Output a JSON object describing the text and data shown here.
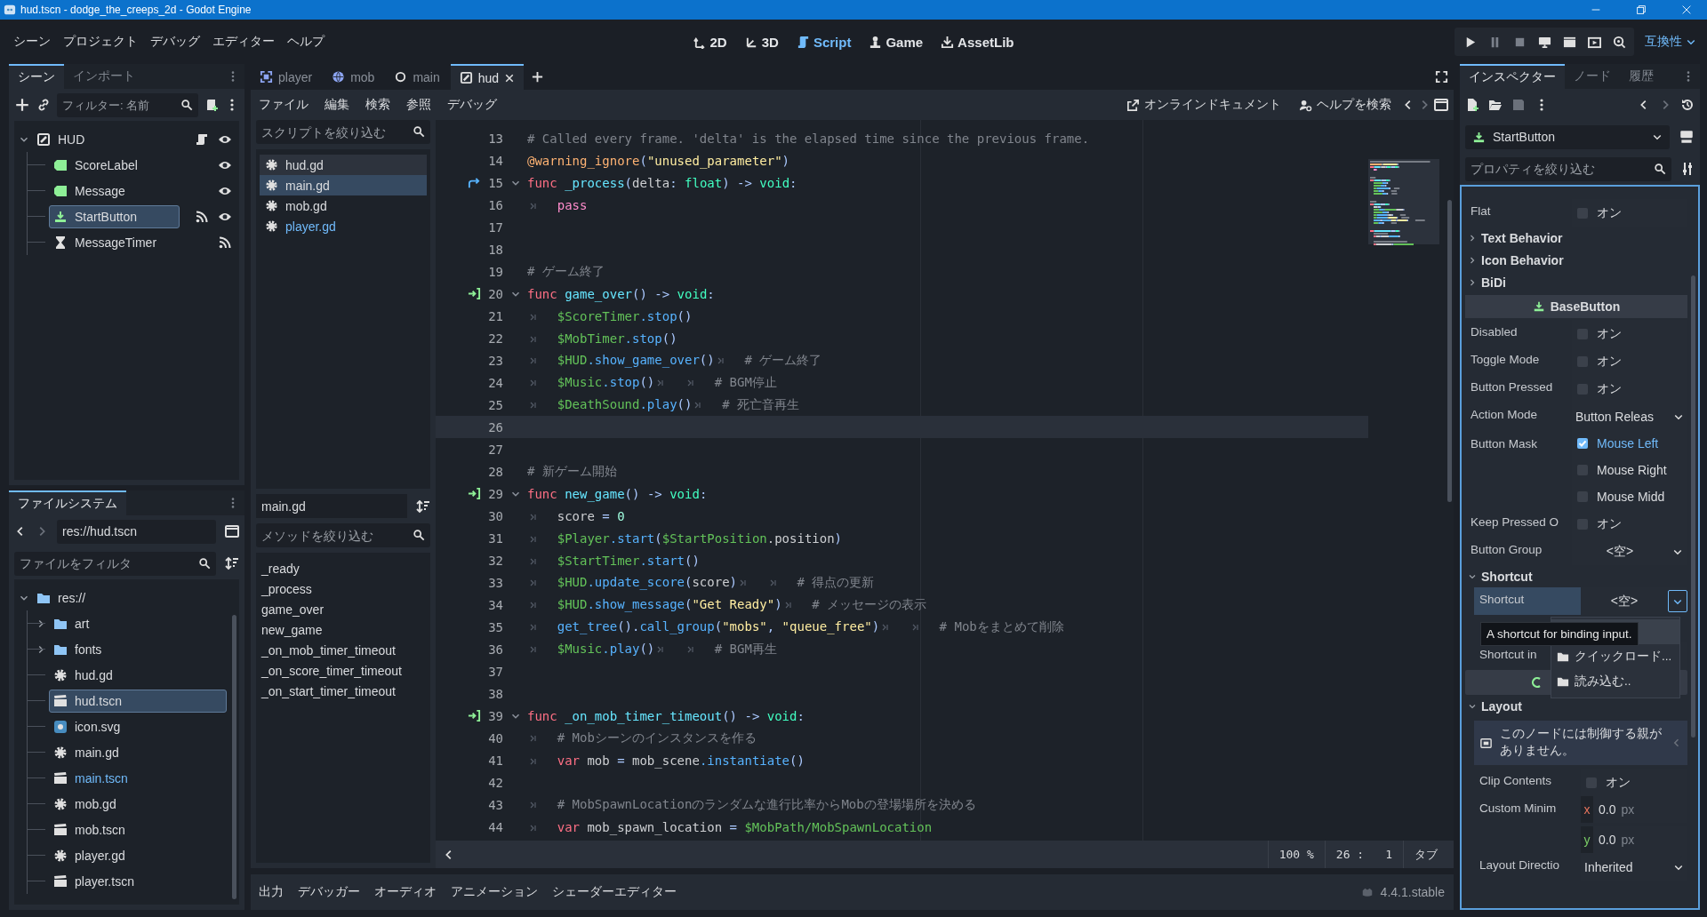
{
  "title_bar": {
    "title": "hud.tscn - dodge_the_creeps_2d - Godot Engine"
  },
  "menu": [
    "シーン",
    "プロジェクト",
    "デバッグ",
    "エディター",
    "ヘルプ"
  ],
  "workspaces": [
    {
      "label": "2D",
      "kind": "ws2d",
      "selected": false
    },
    {
      "label": "3D",
      "kind": "ws3d",
      "selected": false
    },
    {
      "label": "Script",
      "kind": "wsscript",
      "selected": true
    },
    {
      "label": "Game",
      "kind": "wsgame",
      "selected": false
    },
    {
      "label": "AssetLib",
      "kind": "wsasset",
      "selected": false
    }
  ],
  "run_buttons": [
    {
      "kind": "play"
    },
    {
      "kind": "pause"
    },
    {
      "kind": "stop"
    },
    {
      "kind": "remote"
    },
    {
      "kind": "movie"
    },
    {
      "kind": "sceneplay"
    },
    {
      "kind": "searchscene"
    }
  ],
  "renderer": "互換性",
  "scene_dock": {
    "tabs": [
      {
        "label": "シーン",
        "selected": true
      },
      {
        "label": "インポート",
        "selected": false
      }
    ],
    "filter_placeholder": "フィルター: 名前",
    "tree": [
      {
        "name": "HUD",
        "kind": "canvaslayer",
        "expanded": true,
        "selected": false,
        "script": true,
        "visible": true,
        "children": [
          {
            "name": "ScoreLabel",
            "kind": "label",
            "selected": false,
            "visible": true
          },
          {
            "name": "Message",
            "kind": "label",
            "selected": false,
            "visible": true
          },
          {
            "name": "StartButton",
            "kind": "button",
            "selected": true,
            "signals": true,
            "visible": true
          },
          {
            "name": "MessageTimer",
            "kind": "timer",
            "selected": false,
            "signals": true
          }
        ]
      }
    ]
  },
  "filesystem": {
    "tab": "ファイルシステム",
    "path": "res://hud.tscn",
    "filter_placeholder": "ファイルをフィルタ",
    "tree": [
      {
        "name": "res://",
        "kind": "folder",
        "expanded": true,
        "selected": false,
        "children": [
          {
            "name": "art",
            "kind": "folder",
            "expanded": false,
            "selected": false
          },
          {
            "name": "fonts",
            "kind": "folder",
            "expanded": false,
            "selected": false
          },
          {
            "name": "hud.gd",
            "kind": "gear",
            "selected": false
          },
          {
            "name": "hud.tscn",
            "kind": "scene",
            "selected": true
          },
          {
            "name": "icon.svg",
            "kind": "image",
            "selected": false
          },
          {
            "name": "main.gd",
            "kind": "gear",
            "selected": false
          },
          {
            "name": "main.tscn",
            "kind": "scene",
            "selected": false,
            "accent": true
          },
          {
            "name": "mob.gd",
            "kind": "gear",
            "selected": false
          },
          {
            "name": "mob.tscn",
            "kind": "scene",
            "selected": false
          },
          {
            "name": "player.gd",
            "kind": "gear",
            "selected": false
          },
          {
            "name": "player.tscn",
            "kind": "scene",
            "selected": false
          }
        ]
      }
    ]
  },
  "editor_tabs": [
    {
      "label": "player",
      "kind": "area2d",
      "selected": false
    },
    {
      "label": "mob",
      "kind": "rigidbody2d",
      "selected": false
    },
    {
      "label": "main",
      "kind": "node",
      "selected": false
    },
    {
      "label": "hud",
      "kind": "canvaslayer",
      "selected": true
    }
  ],
  "script_menu": [
    "ファイル",
    "編集",
    "検索",
    "参照",
    "デバッグ"
  ],
  "script_links": [
    {
      "label": "オンラインドキュメント",
      "kind": "external"
    },
    {
      "label": "ヘルプを検索",
      "kind": "helpsearch"
    }
  ],
  "scripts": {
    "filter_placeholder": "スクリプトを絞り込む",
    "items": [
      {
        "name": "hud.gd",
        "selected": false,
        "hovered": true,
        "accent": false
      },
      {
        "name": "main.gd",
        "selected": true,
        "hovered": false,
        "accent": false
      },
      {
        "name": "mob.gd",
        "selected": false,
        "hovered": false,
        "accent": false
      },
      {
        "name": "player.gd",
        "selected": false,
        "hovered": false,
        "accent": true
      }
    ],
    "current": "main.gd",
    "method_filter_placeholder": "メソッドを絞り込む",
    "methods": [
      "_ready",
      "_process",
      "game_over",
      "new_game",
      "_on_mob_timer_timeout",
      "_on_score_timer_timeout",
      "_on_start_timer_timeout"
    ]
  },
  "code": {
    "lines": [
      {
        "number": "13",
        "s": [
          {
            "kind": "cmt",
            "text": "# Called every frame. 'delta' is the elapsed time since the previous frame."
          }
        ]
      },
      {
        "number": "14",
        "s": [
          {
            "kind": "ann",
            "text": "@warning_ignore"
          },
          {
            "kind": "sym",
            "text": "("
          },
          {
            "kind": "str",
            "text": "\"unused_parameter\""
          },
          {
            "kind": "sym",
            "text": ")"
          }
        ]
      },
      {
        "number": "15",
        "kind": "override",
        "foldable": true,
        "s": [
          {
            "kind": "kw",
            "text": "func "
          },
          {
            "kind": "fn",
            "text": "_process"
          },
          {
            "kind": "sym",
            "text": "("
          },
          {
            "kind": "plain",
            "text": "delta"
          },
          {
            "kind": "sym",
            "text": ": "
          },
          {
            "kind": "type",
            "text": "float"
          },
          {
            "kind": "sym",
            "text": ") -> "
          },
          {
            "kind": "type",
            "text": "void"
          },
          {
            "kind": "sym",
            "text": ":"
          }
        ]
      },
      {
        "number": "16",
        "s": [
          {
            "kind": "tab"
          },
          {
            "kind": "ctrl",
            "text": "pass"
          }
        ]
      },
      {
        "number": "17"
      },
      {
        "number": "18"
      },
      {
        "number": "19",
        "s": [
          {
            "kind": "cmt",
            "text": "# ゲーム終了"
          }
        ]
      },
      {
        "number": "20",
        "kind": "signal",
        "foldable": true,
        "s": [
          {
            "kind": "kw",
            "text": "func "
          },
          {
            "kind": "fn",
            "text": "game_over"
          },
          {
            "kind": "sym",
            "text": "() -> "
          },
          {
            "kind": "type",
            "text": "void"
          },
          {
            "kind": "sym",
            "text": ":"
          }
        ]
      },
      {
        "number": "21",
        "s": [
          {
            "kind": "tab"
          },
          {
            "kind": "node",
            "text": "$ScoreTimer"
          },
          {
            "kind": "call",
            "text": ".stop"
          },
          {
            "kind": "sym",
            "text": "()"
          }
        ]
      },
      {
        "number": "22",
        "s": [
          {
            "kind": "tab"
          },
          {
            "kind": "node",
            "text": "$MobTimer"
          },
          {
            "kind": "call",
            "text": ".stop"
          },
          {
            "kind": "sym",
            "text": "()"
          }
        ]
      },
      {
        "number": "23",
        "s": [
          {
            "kind": "tab"
          },
          {
            "kind": "node",
            "text": "$HUD"
          },
          {
            "kind": "call",
            "text": ".show_game_over"
          },
          {
            "kind": "sym",
            "text": "()"
          },
          {
            "kind": "tab"
          },
          {
            "kind": "cmt",
            "text": "# ゲーム終了"
          }
        ]
      },
      {
        "number": "24",
        "s": [
          {
            "kind": "tab"
          },
          {
            "kind": "node",
            "text": "$Music"
          },
          {
            "kind": "call",
            "text": ".stop"
          },
          {
            "kind": "sym",
            "text": "()"
          },
          {
            "kind": "tab"
          },
          {
            "kind": "tab"
          },
          {
            "kind": "cmt",
            "text": "# BGM停止"
          }
        ]
      },
      {
        "number": "25",
        "s": [
          {
            "kind": "tab"
          },
          {
            "kind": "node",
            "text": "$DeathSound"
          },
          {
            "kind": "call",
            "text": ".play"
          },
          {
            "kind": "sym",
            "text": "()"
          },
          {
            "kind": "tab"
          },
          {
            "kind": "cmt",
            "text": "# 死亡音再生"
          }
        ]
      },
      {
        "number": "26",
        "current": true
      },
      {
        "number": "27"
      },
      {
        "number": "28",
        "s": [
          {
            "kind": "cmt",
            "text": "# 新ゲーム開始"
          }
        ]
      },
      {
        "number": "29",
        "kind": "signal",
        "foldable": true,
        "s": [
          {
            "kind": "kw",
            "text": "func "
          },
          {
            "kind": "fn",
            "text": "new_game"
          },
          {
            "kind": "sym",
            "text": "() -> "
          },
          {
            "kind": "type",
            "text": "void"
          },
          {
            "kind": "sym",
            "text": ":"
          }
        ]
      },
      {
        "number": "30",
        "s": [
          {
            "kind": "tab"
          },
          {
            "kind": "plain",
            "text": "score"
          },
          {
            "kind": "sym",
            "text": " = "
          },
          {
            "kind": "num",
            "text": "0"
          }
        ]
      },
      {
        "number": "31",
        "s": [
          {
            "kind": "tab"
          },
          {
            "kind": "node",
            "text": "$Player"
          },
          {
            "kind": "call",
            "text": ".start"
          },
          {
            "kind": "sym",
            "text": "("
          },
          {
            "kind": "node",
            "text": "$StartPosition"
          },
          {
            "kind": "plain",
            "text": ".position"
          },
          {
            "kind": "sym",
            "text": ")"
          }
        ]
      },
      {
        "number": "32",
        "s": [
          {
            "kind": "tab"
          },
          {
            "kind": "node",
            "text": "$StartTimer"
          },
          {
            "kind": "call",
            "text": ".start"
          },
          {
            "kind": "sym",
            "text": "()"
          }
        ]
      },
      {
        "number": "33",
        "s": [
          {
            "kind": "tab"
          },
          {
            "kind": "node",
            "text": "$HUD"
          },
          {
            "kind": "call",
            "text": ".update_score"
          },
          {
            "kind": "sym",
            "text": "("
          },
          {
            "kind": "plain",
            "text": "score"
          },
          {
            "kind": "sym",
            "text": ")"
          },
          {
            "kind": "tab"
          },
          {
            "kind": "tab"
          },
          {
            "kind": "cmt",
            "text": "# 得点の更新"
          }
        ]
      },
      {
        "number": "34",
        "s": [
          {
            "kind": "tab"
          },
          {
            "kind": "node",
            "text": "$HUD"
          },
          {
            "kind": "call",
            "text": ".show_message"
          },
          {
            "kind": "sym",
            "text": "("
          },
          {
            "kind": "str",
            "text": "\"Get Ready\""
          },
          {
            "kind": "sym",
            "text": ")"
          },
          {
            "kind": "tab"
          },
          {
            "kind": "cmt",
            "text": "# メッセージの表示"
          }
        ]
      },
      {
        "number": "35",
        "s": [
          {
            "kind": "tab"
          },
          {
            "kind": "call",
            "text": "get_tree"
          },
          {
            "kind": "sym",
            "text": "()."
          },
          {
            "kind": "call",
            "text": "call_group"
          },
          {
            "kind": "sym",
            "text": "("
          },
          {
            "kind": "str",
            "text": "\"mobs\""
          },
          {
            "kind": "sym",
            "text": ", "
          },
          {
            "kind": "str",
            "text": "\"queue_free\""
          },
          {
            "kind": "sym",
            "text": ")"
          },
          {
            "kind": "tab"
          },
          {
            "kind": "tab"
          },
          {
            "kind": "cmt",
            "text": "# Mobをまとめて削除"
          }
        ]
      },
      {
        "number": "36",
        "s": [
          {
            "kind": "tab"
          },
          {
            "kind": "node",
            "text": "$Music"
          },
          {
            "kind": "call",
            "text": ".play"
          },
          {
            "kind": "sym",
            "text": "()"
          },
          {
            "kind": "tab"
          },
          {
            "kind": "tab"
          },
          {
            "kind": "cmt",
            "text": "# BGM再生"
          }
        ]
      },
      {
        "number": "37"
      },
      {
        "number": "38"
      },
      {
        "number": "39",
        "kind": "signal",
        "foldable": true,
        "s": [
          {
            "kind": "kw",
            "text": "func "
          },
          {
            "kind": "fn",
            "text": "_on_mob_timer_timeout"
          },
          {
            "kind": "sym",
            "text": "() -> "
          },
          {
            "kind": "type",
            "text": "void"
          },
          {
            "kind": "sym",
            "text": ":"
          }
        ]
      },
      {
        "number": "40",
        "s": [
          {
            "kind": "tab"
          },
          {
            "kind": "cmt",
            "text": "# Mobシーンのインスタンスを作る"
          }
        ]
      },
      {
        "number": "41",
        "s": [
          {
            "kind": "tab"
          },
          {
            "kind": "kw",
            "text": "var"
          },
          {
            "kind": "plain",
            "text": " mob "
          },
          {
            "kind": "sym",
            "text": "= "
          },
          {
            "kind": "plain",
            "text": "mob_scene"
          },
          {
            "kind": "call",
            "text": ".instantiate"
          },
          {
            "kind": "sym",
            "text": "()"
          }
        ]
      },
      {
        "number": "42"
      },
      {
        "number": "43",
        "s": [
          {
            "kind": "tab"
          },
          {
            "kind": "cmt",
            "text": "# MobSpawnLocationのランダムな進行比率からMobの登場場所を決める"
          }
        ]
      },
      {
        "number": "44",
        "s": [
          {
            "kind": "tab"
          },
          {
            "kind": "kw",
            "text": "var"
          },
          {
            "kind": "plain",
            "text": " mob_spawn_location "
          },
          {
            "kind": "sym",
            "text": "= "
          },
          {
            "kind": "node",
            "text": "$MobPath/MobSpawnLocation"
          }
        ]
      }
    ],
    "status": {
      "zoom": "100 %",
      "line": "26 :",
      "column": "1",
      "indent": "タブ"
    }
  },
  "bottom_panel": {
    "tabs": [
      "出力",
      "デバッガー",
      "オーディオ",
      "アニメーション",
      "シェーダーエディター"
    ],
    "version": "4.4.1.stable"
  },
  "inspector": {
    "tabs": [
      {
        "label": "インスペクター",
        "selected": true
      },
      {
        "label": "ノード",
        "selected": false
      },
      {
        "label": "履歴",
        "selected": false
      }
    ],
    "object": "StartButton",
    "filter_placeholder": "プロパティを絞り込む",
    "rows": [
      {
        "kind": "check",
        "label": "Flat",
        "text": "オン",
        "checked": false
      },
      {
        "kind": "group",
        "label": "Text Behavior",
        "expanded": false
      },
      {
        "kind": "group",
        "label": "Icon Behavior",
        "expanded": false
      },
      {
        "kind": "group",
        "label": "BiDi",
        "expanded": false
      },
      {
        "kind": "category",
        "label": "BaseButton"
      },
      {
        "kind": "check",
        "label": "Disabled",
        "text": "オン",
        "checked": false
      },
      {
        "kind": "check",
        "label": "Toggle Mode",
        "text": "オン",
        "checked": false
      },
      {
        "kind": "check",
        "label": "Button Pressed",
        "text": "オン",
        "checked": false
      },
      {
        "kind": "dropdown",
        "label": "Action Mode",
        "value": "Button Releas"
      },
      {
        "kind": "flags",
        "label": "Button Mask",
        "options": [
          {
            "text": "Mouse Left",
            "checked": true
          },
          {
            "text": "Mouse Right",
            "checked": false
          },
          {
            "text": "Mouse Midd",
            "checked": false
          }
        ]
      },
      {
        "kind": "check",
        "label": "Keep Pressed O",
        "text": "オン",
        "checked": false
      },
      {
        "kind": "resource",
        "label": "Button Group",
        "value": "<空>",
        "selected": false,
        "menu_open": false
      },
      {
        "kind": "group",
        "label": "Shortcut",
        "expanded": true,
        "children": [
          {
            "kind": "resource",
            "label": "Shortcut",
            "value": "<空>",
            "selected": true,
            "menu_open": true
          },
          {
            "kind": "hidden"
          },
          {
            "kind": "label",
            "label": "Shortcut in"
          },
          {
            "kind": "button"
          }
        ]
      },
      {
        "kind": "group",
        "label": "Layout",
        "expanded": true,
        "children": [
          {
            "kind": "warning",
            "text": "このノードには制御する親がありません。"
          },
          {
            "kind": "check",
            "label": "Clip Contents",
            "text": "オン",
            "checked": false
          },
          {
            "kind": "vector",
            "label": "Custom Minim",
            "components": [
              {
                "axis": "x",
                "value": "0.0",
                "unit": "px"
              },
              {
                "axis": "y",
                "value": "0.0",
                "unit": "px"
              }
            ]
          },
          {
            "kind": "dropdown",
            "label": "Layout Directio",
            "value": "Inherited"
          }
        ]
      }
    ],
    "tooltip": "A shortcut for binding input.",
    "popup_menu": [
      {
        "highlighted": true
      },
      {
        "label": "クイックロード...",
        "highlighted": false
      },
      {
        "label": "読み込む..",
        "highlighted": false
      }
    ]
  }
}
